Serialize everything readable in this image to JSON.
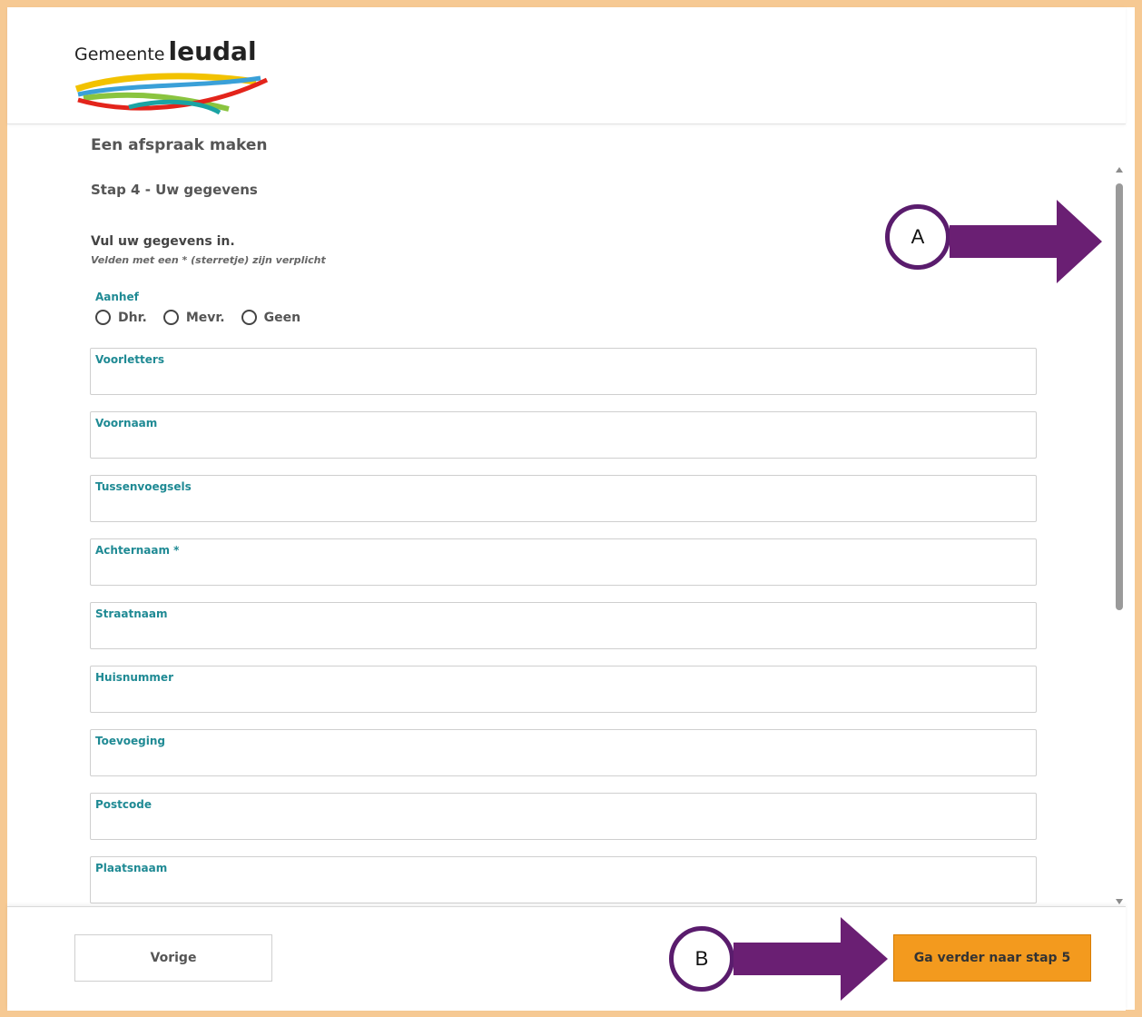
{
  "header": {
    "logo_prefix": "Gemeente",
    "logo_brand": "leudal"
  },
  "page": {
    "title": "Een afspraak maken",
    "step": "Stap 4 - Uw gegevens",
    "intro": "Vul uw gegevens in.",
    "required_note": "Velden met een * (sterretje) zijn verplicht"
  },
  "aanhef": {
    "label": "Aanhef",
    "options": [
      "Dhr.",
      "Mevr.",
      "Geen"
    ]
  },
  "fields": [
    {
      "label": "Voorletters",
      "value": ""
    },
    {
      "label": "Voornaam",
      "value": ""
    },
    {
      "label": "Tussenvoegsels",
      "value": ""
    },
    {
      "label": "Achternaam *",
      "value": ""
    },
    {
      "label": "Straatnaam",
      "value": ""
    },
    {
      "label": "Huisnummer",
      "value": ""
    },
    {
      "label": "Toevoeging",
      "value": ""
    },
    {
      "label": "Postcode",
      "value": ""
    },
    {
      "label": "Plaatsnaam",
      "value": ""
    }
  ],
  "footer": {
    "prev_label": "Vorige",
    "next_label": "Ga verder naar stap 5"
  },
  "annotations": {
    "marker_a": "A",
    "marker_b": "B",
    "arrow_color": "#6a1f73"
  },
  "colors": {
    "frame": "#f6c993",
    "accent_teal": "#1f8a94",
    "primary_button": "#f39a1e"
  }
}
